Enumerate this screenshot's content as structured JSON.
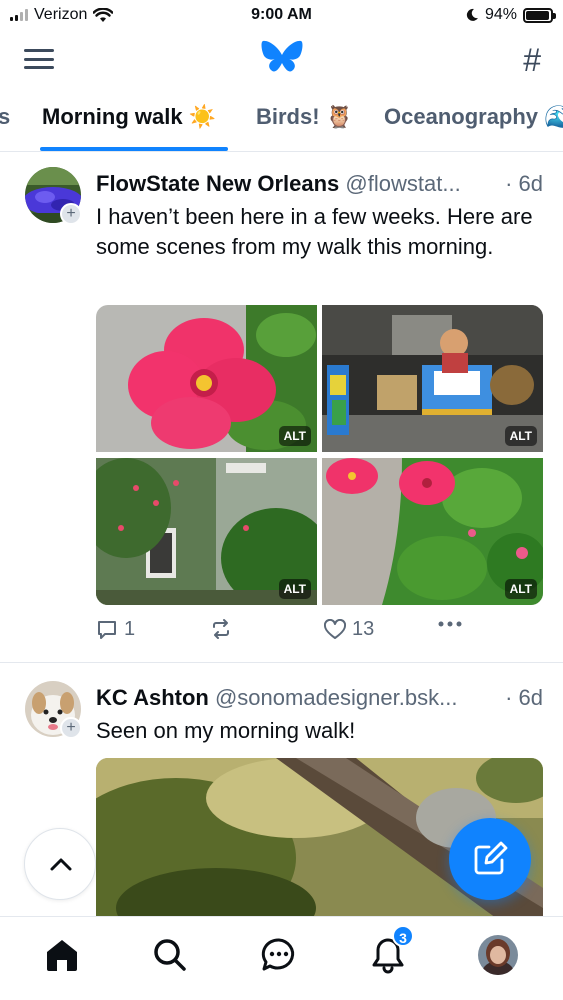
{
  "status_bar": {
    "carrier": "Verizon",
    "time": "9:00 AM",
    "battery": "94%",
    "battery_level": 0.94
  },
  "header": {
    "menu_icon": "hamburger-menu-icon",
    "logo_icon": "butterfly-logo-icon",
    "feeds_icon": "hash-icon"
  },
  "tabs": [
    {
      "label": "s",
      "active": false
    },
    {
      "label": "Morning walk ☀️",
      "active": true
    },
    {
      "label": "Birds! 🦉",
      "active": false
    },
    {
      "label": "Oceanography 🌊",
      "active": false
    }
  ],
  "posts": [
    {
      "author": "FlowState New Orleans",
      "handle": "@flowstat...",
      "time": "· 6d",
      "text": "I haven’t been here in a few weeks. Here are some scenes from my walk this morning.",
      "images": [
        {
          "alt_badge": "ALT",
          "subject": "pink hibiscus flower"
        },
        {
          "alt_badge": "ALT",
          "subject": "parade float warehouse"
        },
        {
          "alt_badge": "ALT",
          "subject": "green house with flowering shrubs"
        },
        {
          "alt_badge": "ALT",
          "subject": "pink hibiscus bush by sidewalk"
        }
      ],
      "replies": "1",
      "reposts": "",
      "likes": "13"
    },
    {
      "author": "KC Ashton",
      "handle": "@sonomadesigner.bsk...",
      "time": "· 6d",
      "text": "Seen on my morning walk!",
      "images": [
        {
          "subject": "tree branch with foliage"
        }
      ]
    }
  ],
  "bottom_nav": {
    "items": [
      "home-icon",
      "search-icon",
      "chat-icon",
      "bell-icon",
      "profile-avatar"
    ],
    "notification_count": "3"
  },
  "colors": {
    "accent": "#1083fe",
    "text": "#0b0f14",
    "muted": "#5b6878"
  }
}
